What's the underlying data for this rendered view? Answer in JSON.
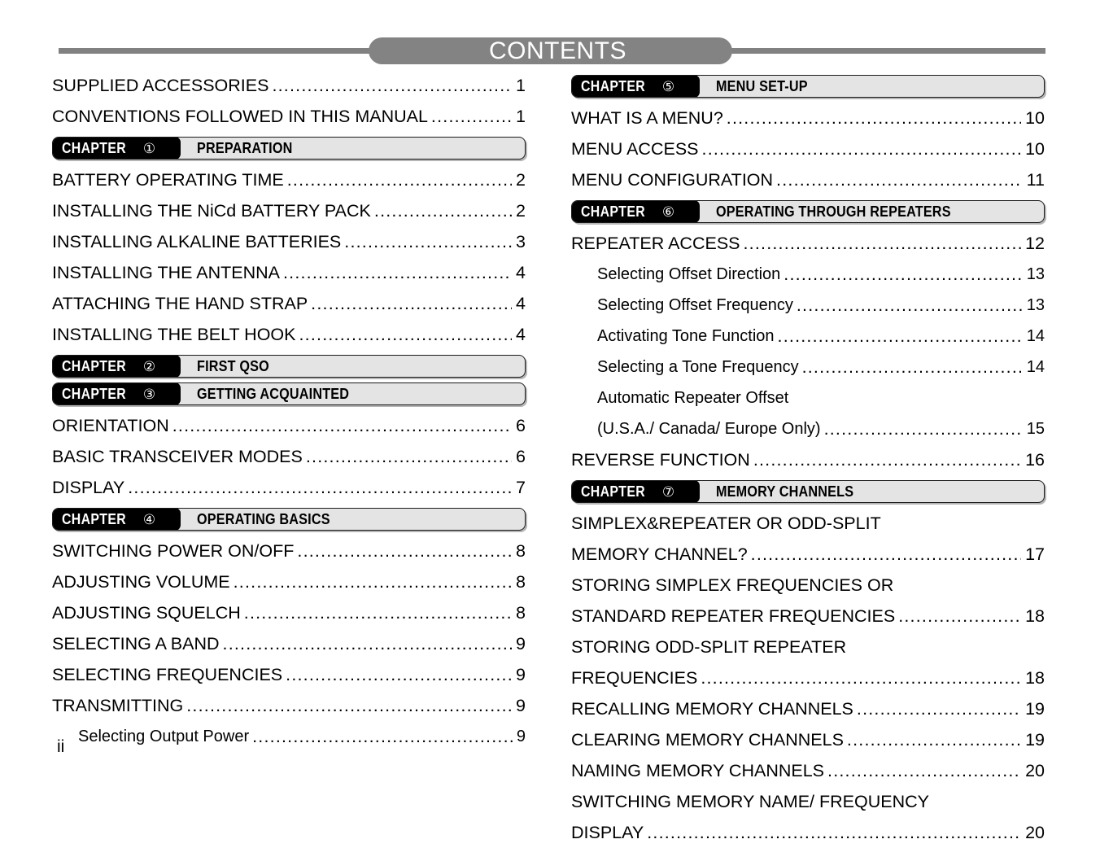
{
  "header": {
    "title": "CONTENTS",
    "pill_color": "#838383",
    "rule_color": "#818181",
    "title_color": "#ffffff"
  },
  "folio": "ii",
  "chapter_bar": {
    "word": "CHAPTER",
    "tag_bg": "#000000",
    "bar_bg": "#e4e4e4"
  },
  "left_column": [
    {
      "kind": "entry",
      "label": "SUPPLIED ACCESSORIES",
      "page": "1"
    },
    {
      "kind": "entry",
      "label": "CONVENTIONS FOLLOWED IN THIS MANUAL",
      "page": "1"
    },
    {
      "kind": "chapter",
      "number": "①",
      "title": "PREPARATION"
    },
    {
      "kind": "entry",
      "label": "BATTERY OPERATING TIME",
      "page": "2"
    },
    {
      "kind": "entry",
      "label": "INSTALLING THE NiCd BATTERY PACK",
      "page": "2"
    },
    {
      "kind": "entry",
      "label": "INSTALLING ALKALINE BATTERIES",
      "page": "3"
    },
    {
      "kind": "entry",
      "label": "INSTALLING THE ANTENNA",
      "page": "4"
    },
    {
      "kind": "entry",
      "label": "ATTACHING THE HAND STRAP",
      "page": "4"
    },
    {
      "kind": "entry",
      "label": "INSTALLING THE BELT HOOK",
      "page": "4"
    },
    {
      "kind": "chapter",
      "number": "②",
      "title": "FIRST QSO"
    },
    {
      "kind": "chapter",
      "number": "③",
      "title": "GETTING ACQUAINTED"
    },
    {
      "kind": "entry",
      "label": "ORIENTATION",
      "page": "6"
    },
    {
      "kind": "entry",
      "label": "BASIC TRANSCEIVER MODES",
      "page": "6"
    },
    {
      "kind": "entry",
      "label": "DISPLAY",
      "page": "7"
    },
    {
      "kind": "chapter",
      "number": "④",
      "title": "OPERATING BASICS"
    },
    {
      "kind": "entry",
      "label": "SWITCHING POWER ON/OFF",
      "page": "8"
    },
    {
      "kind": "entry",
      "label": "ADJUSTING VOLUME",
      "page": "8"
    },
    {
      "kind": "entry",
      "label": "ADJUSTING SQUELCH",
      "page": "8"
    },
    {
      "kind": "entry",
      "label": "SELECTING A BAND",
      "page": "9"
    },
    {
      "kind": "entry",
      "label": "SELECTING FREQUENCIES",
      "page": "9"
    },
    {
      "kind": "entry",
      "label": "TRANSMITTING",
      "page": "9"
    },
    {
      "kind": "sub",
      "label": "Selecting Output Power",
      "page": "9"
    }
  ],
  "right_column": [
    {
      "kind": "chapter",
      "number": "⑤",
      "title": "MENU SET-UP"
    },
    {
      "kind": "entry",
      "label": "WHAT IS A MENU?",
      "page": "10"
    },
    {
      "kind": "entry",
      "label": "MENU ACCESS",
      "page": "10"
    },
    {
      "kind": "entry",
      "label": "MENU CONFIGURATION",
      "page": "11"
    },
    {
      "kind": "chapter",
      "number": "⑥",
      "title": "OPERATING THROUGH REPEATERS"
    },
    {
      "kind": "entry",
      "label": "REPEATER ACCESS",
      "page": "12"
    },
    {
      "kind": "sub",
      "label": "Selecting Offset Direction",
      "page": "13"
    },
    {
      "kind": "sub",
      "label": "Selecting Offset Frequency",
      "page": "13"
    },
    {
      "kind": "sub",
      "label": "Activating Tone Function",
      "page": "14"
    },
    {
      "kind": "sub",
      "label": "Selecting a Tone Frequency",
      "page": "14"
    },
    {
      "kind": "sub2",
      "line1": "Automatic Repeater Offset",
      "label": "(U.S.A./ Canada/ Europe Only)",
      "page": "15"
    },
    {
      "kind": "entry",
      "label": "REVERSE FUNCTION",
      "page": "16"
    },
    {
      "kind": "chapter",
      "number": "⑦",
      "title": "MEMORY CHANNELS"
    },
    {
      "kind": "entry2",
      "line1": "SIMPLEX&REPEATER OR ODD-SPLIT",
      "label": "MEMORY CHANNEL?",
      "page": "17"
    },
    {
      "kind": "entry2",
      "line1": "STORING SIMPLEX FREQUENCIES OR",
      "label": "STANDARD REPEATER FREQUENCIES",
      "page": "18"
    },
    {
      "kind": "entry2",
      "line1": "STORING ODD-SPLIT REPEATER",
      "label": "FREQUENCIES",
      "page": "18"
    },
    {
      "kind": "entry",
      "label": "RECALLING MEMORY CHANNELS",
      "page": "19"
    },
    {
      "kind": "entry",
      "label": "CLEARING MEMORY CHANNELS",
      "page": "19"
    },
    {
      "kind": "entry",
      "label": "NAMING MEMORY CHANNELS",
      "page": "20"
    },
    {
      "kind": "entry2",
      "line1": "SWITCHING MEMORY NAME/ FREQUENCY",
      "label": "DISPLAY",
      "page": "20"
    }
  ]
}
